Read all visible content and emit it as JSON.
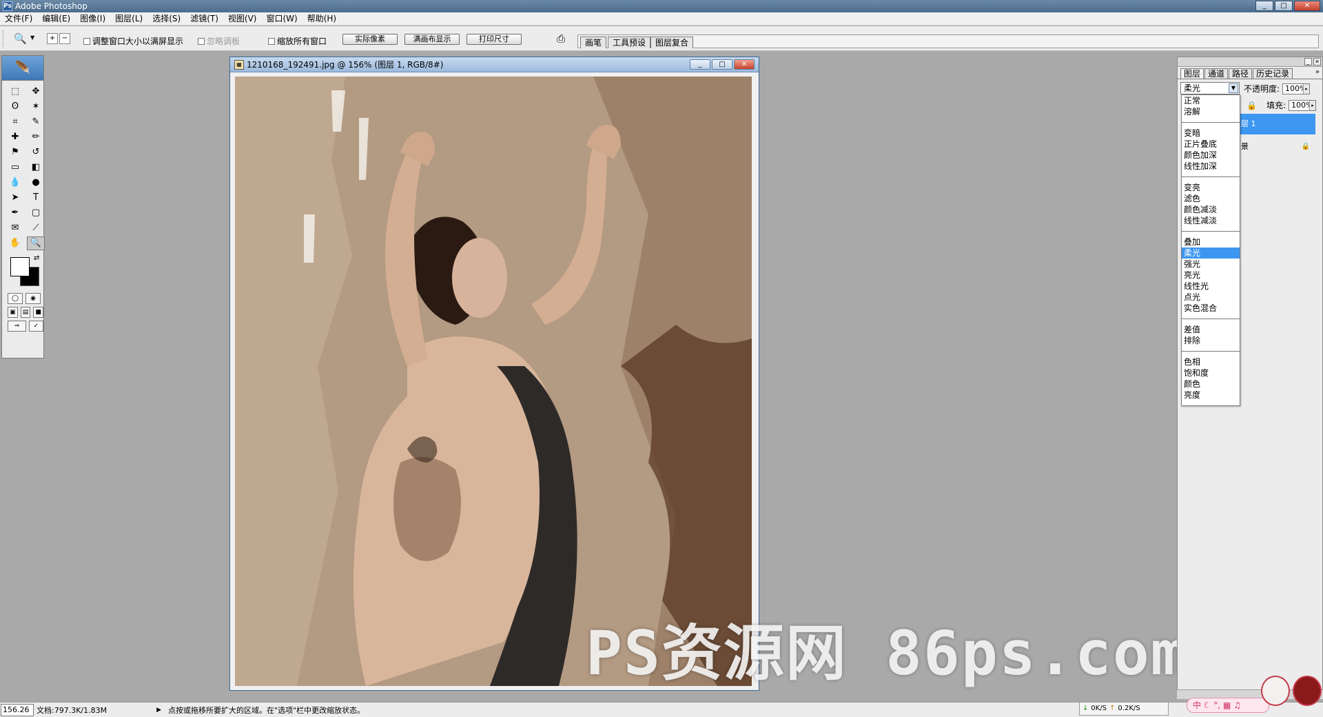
{
  "app": {
    "title": "Adobe Photoshop",
    "logo_text": "Ps"
  },
  "window_controls": {
    "min": "_",
    "max": "□",
    "close": "✕"
  },
  "menu": [
    "文件(F)",
    "编辑(E)",
    "图像(I)",
    "图层(L)",
    "选择(S)",
    "滤镜(T)",
    "视图(V)",
    "窗口(W)",
    "帮助(H)"
  ],
  "options_bar": {
    "tool_icon": "zoom-icon",
    "fit_window_label": "调整窗口大小以满屏显示",
    "ignore_palettes_label": "忽略调板",
    "zoom_all_label": "缩放所有窗口",
    "actual_pixels_label": "实际像素",
    "fit_screen_label": "满画布显示",
    "print_size_label": "打印尺寸"
  },
  "palette_well": {
    "tabs": [
      "画笔",
      "工具预设",
      "图层复合"
    ]
  },
  "toolbox": {
    "tools": [
      "marquee",
      "move",
      "lasso",
      "magic-wand",
      "crop",
      "slice",
      "healing",
      "brush",
      "stamp",
      "history-brush",
      "eraser",
      "gradient",
      "blur",
      "dodge",
      "path-select",
      "type",
      "pen",
      "shape",
      "notes",
      "eyedropper",
      "hand",
      "zoom"
    ],
    "glyphs": [
      "⬚",
      "✥",
      "ʘ",
      "✶",
      "⌗",
      "✎",
      "✚",
      "✏",
      "⚑",
      "↺",
      "▭",
      "◧",
      "💧",
      "●",
      "➤",
      "T",
      "✒",
      "▢",
      "✉",
      "⟋",
      "✋",
      "🔍"
    ],
    "fg_color": "#ffffff",
    "bg_color": "#000000"
  },
  "document": {
    "title": "1210168_192491.jpg @ 156% (图层 1, RGB/8#)",
    "watermark": "PS资源网  86ps.com"
  },
  "layers_panel": {
    "tabs": [
      "图层",
      "通道",
      "路径",
      "历史记录"
    ],
    "blend_mode": "柔光",
    "opacity_label": "不透明度:",
    "opacity_value": "100%",
    "fill_label": "填充:",
    "fill_value": "100%",
    "layers": [
      {
        "name": "层 1",
        "selected": true
      },
      {
        "name": "景",
        "selected": false
      }
    ]
  },
  "blend_dropdown": {
    "groups": [
      [
        "正常",
        "溶解"
      ],
      [
        "变暗",
        "正片叠底",
        "颜色加深",
        "线性加深"
      ],
      [
        "变亮",
        "滤色",
        "颜色减淡",
        "线性减淡"
      ],
      [
        "叠加",
        "柔光",
        "强光",
        "亮光",
        "线性光",
        "点光",
        "实色混合"
      ],
      [
        "差值",
        "排除"
      ],
      [
        "色相",
        "饱和度",
        "颜色",
        "亮度"
      ]
    ],
    "selected": "柔光"
  },
  "status_bar": {
    "zoom": "156.26",
    "doc_size": "文档:797.3K/1.83M",
    "hint": "点按或拖移所要扩大的区域。在\"选项\"栏中更改缩放状态。"
  },
  "netmon": {
    "down": "0K/S",
    "up": "0.2K/S"
  },
  "ime": {
    "label": "中 ☾ °, ▦ ♫"
  },
  "colors": {
    "accent": "#3d97f0",
    "title_bar": "#4d6c8c",
    "workspace": "#a9a9a9"
  }
}
